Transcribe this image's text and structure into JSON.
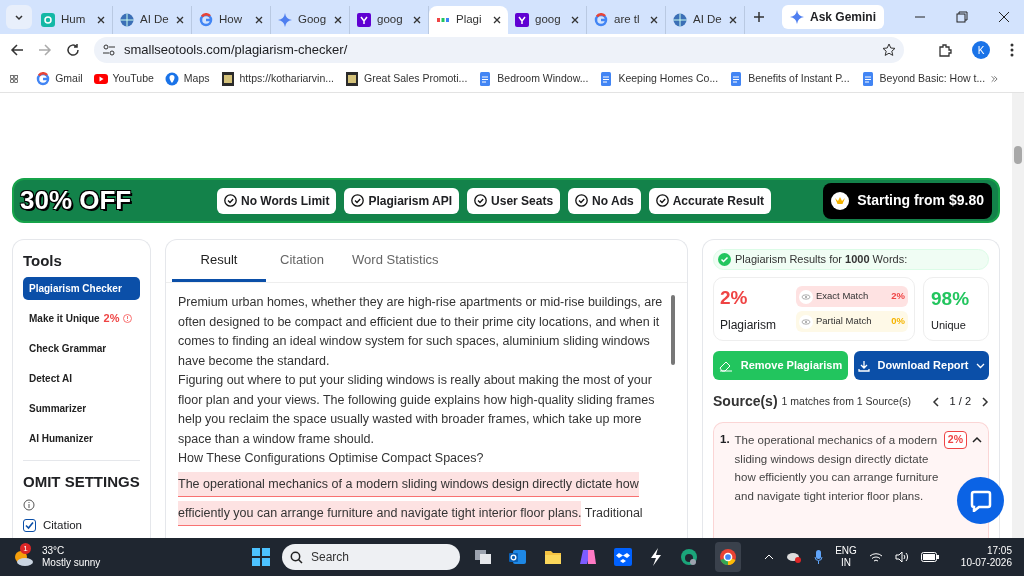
{
  "browser": {
    "tabs": [
      {
        "title": "Hum",
        "kind": "teal",
        "selected": false
      },
      {
        "title": "AI De",
        "kind": "globe",
        "selected": false
      },
      {
        "title": "How",
        "kind": "google",
        "selected": false
      },
      {
        "title": "Goog",
        "kind": "gemini",
        "selected": false
      },
      {
        "title": "goog",
        "kind": "yahoo",
        "selected": false
      },
      {
        "title": "Plagi",
        "kind": "site",
        "selected": true
      },
      {
        "title": "goog",
        "kind": "yahoo",
        "selected": false
      },
      {
        "title": "are tl",
        "kind": "google",
        "selected": false
      },
      {
        "title": "AI De",
        "kind": "globe",
        "selected": false
      }
    ],
    "ask_gemini": "Ask Gemini",
    "url": "smallseotools.com/plagiarism-checker/",
    "profile": "K",
    "bookmarks": [
      {
        "label": "Gmail",
        "kind": "google"
      },
      {
        "label": "YouTube",
        "kind": "youtube"
      },
      {
        "label": "Maps",
        "kind": "maps"
      },
      {
        "label": "https://kothariarvin...",
        "kind": "dark"
      },
      {
        "label": "Great Sales Promoti...",
        "kind": "dark"
      },
      {
        "label": "Bedroom Window...",
        "kind": "doc"
      },
      {
        "label": "Keeping Homes Co...",
        "kind": "doc"
      },
      {
        "label": "Benefits of Instant P...",
        "kind": "doc"
      },
      {
        "label": "Beyond Basic: How t...",
        "kind": "doc"
      }
    ]
  },
  "promo": {
    "discount": "30% OFF",
    "features": [
      "No Words Limit",
      "Plagiarism API",
      "User Seats",
      "No Ads",
      "Accurate Result"
    ],
    "price": "Starting from $9.80"
  },
  "sidebar": {
    "title": "Tools",
    "items": [
      {
        "label": "Plagiarism Checker",
        "selected": true
      },
      {
        "label": "Make it Unique",
        "badge": "2%",
        "selected": false
      },
      {
        "label": "Check Grammar",
        "selected": false
      },
      {
        "label": "Detect AI",
        "selected": false
      },
      {
        "label": "Summarizer",
        "selected": false
      },
      {
        "label": "AI Humanizer",
        "selected": false
      }
    ],
    "omit_title": "OMIT SETTINGS",
    "options": [
      {
        "label": "Citation",
        "checked": true
      }
    ]
  },
  "main": {
    "tabs": [
      {
        "label": "Result",
        "selected": true
      },
      {
        "label": "Citation",
        "selected": false
      },
      {
        "label": "Word Statistics",
        "selected": false
      }
    ],
    "paragraphs": [
      [
        {
          "text": "Premium urban homes, whether they are high-rise apartments or mid-rise buildings, are often designed to be compact and efficient due to their prime city locations, and when it comes to finding an ideal window system for such spaces, aluminium sliding windows have become the standard.",
          "highlighted": false
        }
      ],
      [
        {
          "text": "Figuring out where to put your sliding windows is really about making the most of your floor plan and your views. The following guide explains how high-quality sliding frames help you reclaim the space usually wasted with broader frames, which take up more space than a window frame should.",
          "highlighted": false
        }
      ],
      [
        {
          "text": "How These Configurations Optimise Compact Spaces?",
          "highlighted": false
        }
      ],
      [
        {
          "text": "The operational mechanics of a modern sliding windows design directly dictate how efficiently you can arrange furniture and navigate tight interior floor plans.",
          "highlighted": true
        },
        {
          "text": " Traditional",
          "highlighted": false
        }
      ]
    ]
  },
  "results": {
    "summary": "Plagiarism Results for **1000** Words:",
    "plagiarism": {
      "value": "2%",
      "label": "Plagiarism"
    },
    "matches": [
      {
        "kind": "exact",
        "label": "Exact Match",
        "value": "2%"
      },
      {
        "kind": "partial",
        "label": "Partial Match",
        "value": "0%"
      }
    ],
    "unique": {
      "value": "98%",
      "label": "Unique"
    },
    "remove_button": "Remove Plagiarism",
    "download_button": "Download Report",
    "sources_title": "Source(s)",
    "sources_count": "1 matches from 1 Source(s)",
    "pager": "1 / 2",
    "sources": [
      {
        "number": "1.",
        "text": "The operational mechanics of a modern sliding windows design directly dictate how efficiently you can arrange furniture and navigate tight interior floor plans.",
        "percent": "2%",
        "expanded": true
      }
    ]
  },
  "taskbar": {
    "badge": "1",
    "temperature": "33°C",
    "weather": "Mostly sunny",
    "search": "Search",
    "language": "ENG",
    "region": "IN",
    "time": "17:05",
    "date": "10-07-2026"
  }
}
